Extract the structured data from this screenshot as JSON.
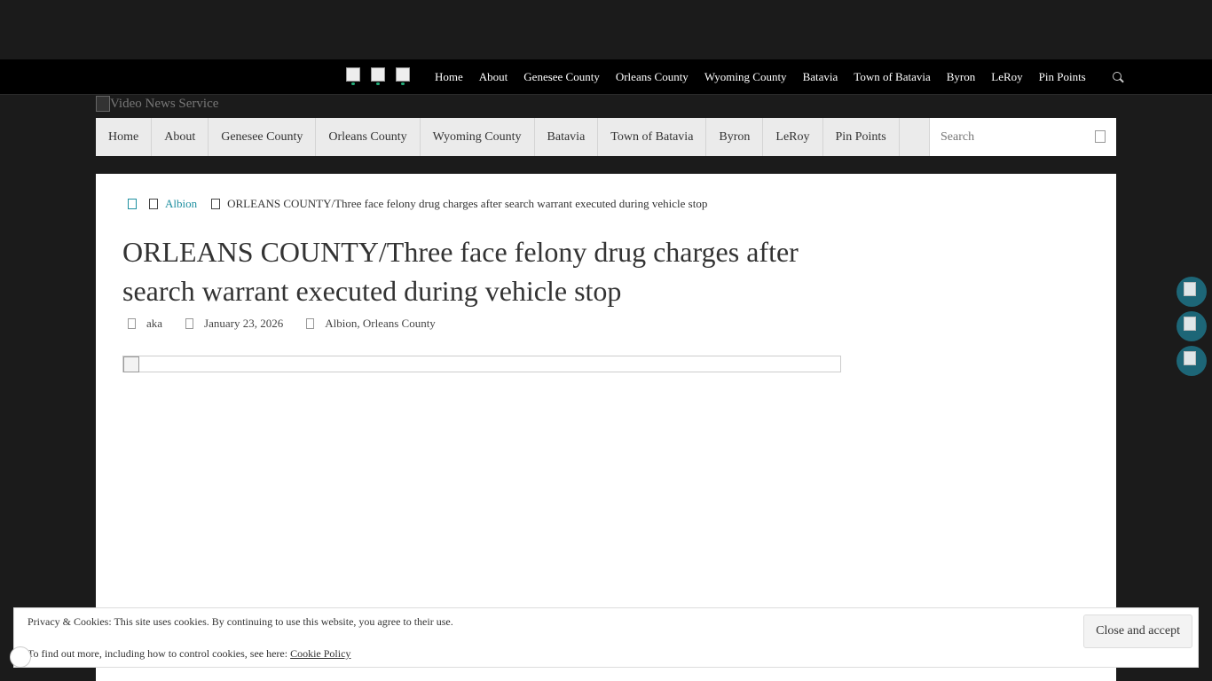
{
  "topnav": {
    "items": [
      "Home",
      "About",
      "Genesee County",
      "Orleans County",
      "Wyoming County",
      "Batavia",
      "Town of Batavia",
      "Byron",
      "LeRoy",
      "Pin Points"
    ],
    "social_icons": [
      "facebook-icon",
      "twitter-icon",
      "youtube-icon"
    ]
  },
  "site": {
    "logo_alt": "Video News Service"
  },
  "mainnav": {
    "items": [
      "Home",
      "About",
      "Genesee County",
      "Orleans County",
      "Wyoming County",
      "Batavia",
      "Town of Batavia",
      "Byron",
      "LeRoy",
      "Pin Points"
    ],
    "search_placeholder": "Search"
  },
  "breadcrumb": {
    "category": "Albion",
    "current": "ORLEANS COUNTY/Three face felony drug charges after search warrant executed during vehicle stop"
  },
  "article": {
    "title": "ORLEANS COUNTY/Three face felony drug charges after search warrant executed during vehicle stop",
    "author": "aka",
    "date": "January 23, 2026",
    "categories": "Albion, Orleans County"
  },
  "cookie": {
    "line1": "Privacy & Cookies: This site uses cookies. By continuing to use this website, you agree to their use.",
    "line2_prefix": "To find out more, including how to control cookies, see here: ",
    "policy_link": "Cookie Policy",
    "button": "Close and accept"
  },
  "colors": {
    "accent": "#1e8fa0",
    "share_bg": "#1d6677"
  }
}
